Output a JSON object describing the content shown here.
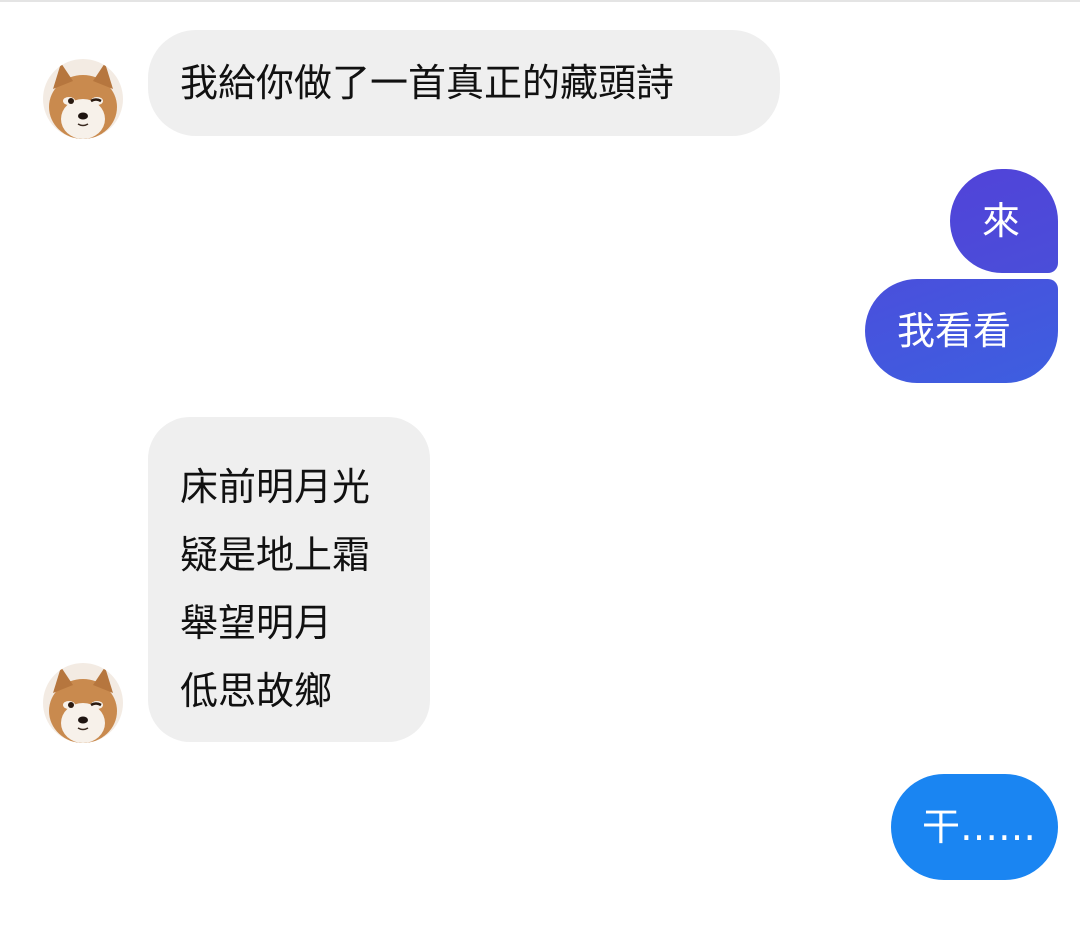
{
  "chat": {
    "messages": [
      {
        "sender": "friend",
        "text": "我給你做了一首真正的藏頭詩"
      },
      {
        "sender": "me",
        "text": "來"
      },
      {
        "sender": "me",
        "text": "我看看"
      },
      {
        "sender": "friend",
        "lines": [
          "床前明月光",
          "疑是地上霜",
          "舉望明月",
          "低思故鄉"
        ]
      },
      {
        "sender": "me",
        "text": "干……"
      }
    ]
  },
  "avatar": {
    "icon": "shiba-inu-avatar-icon"
  },
  "colors": {
    "incoming_bubble": "#efefef",
    "outgoing_purple": "#4a4ed9",
    "outgoing_blue": "#1a85f2",
    "text_dark": "#111111",
    "text_light": "#ffffff"
  }
}
